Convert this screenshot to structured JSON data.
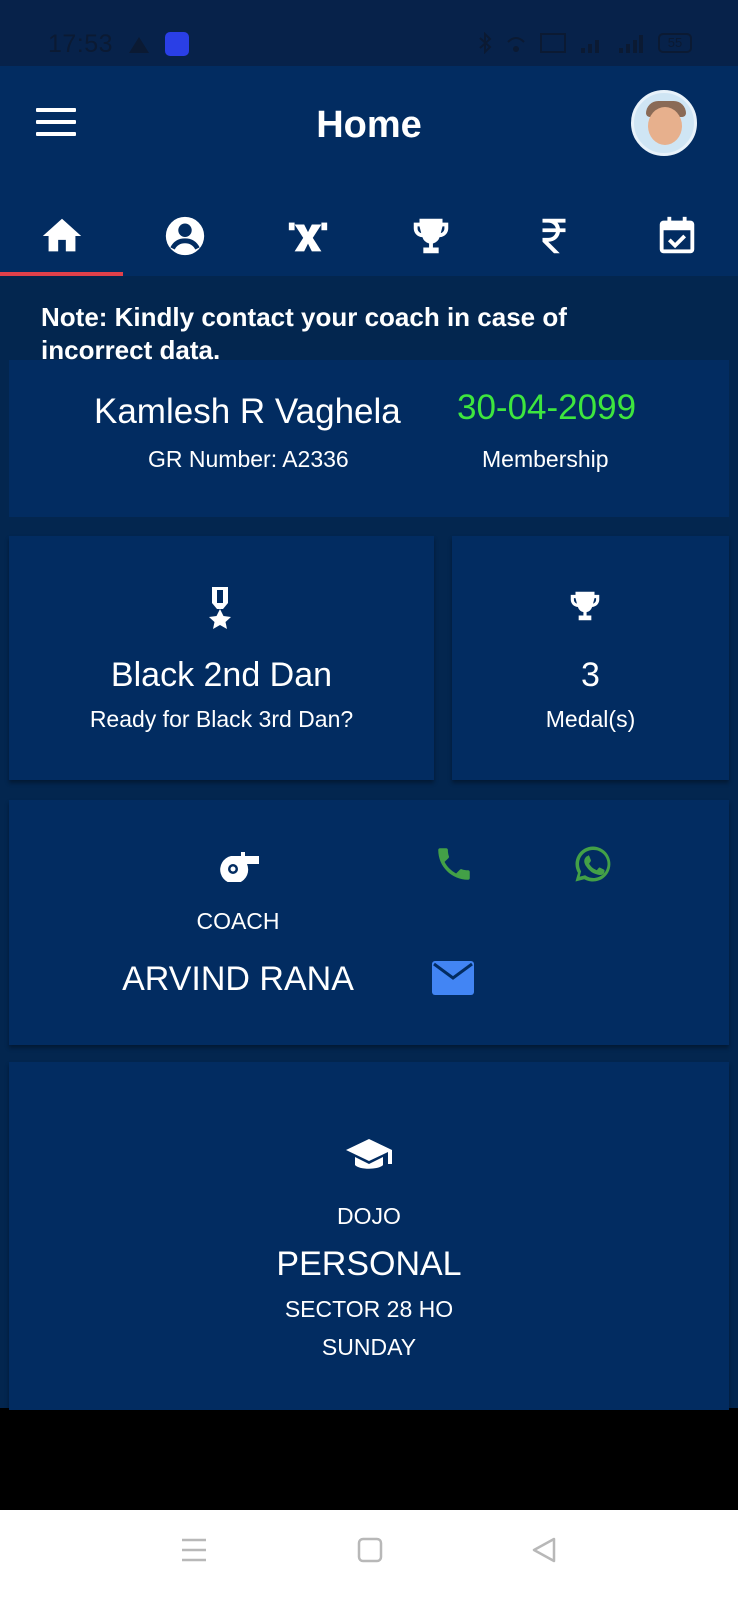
{
  "status_bar": {
    "time": "17:53",
    "battery": "55",
    "icons": [
      "warning-icon",
      "app-notification-icon",
      "bluetooth-icon",
      "wifi-icon",
      "volte-icon",
      "signal-icon",
      "signal-icon",
      "battery-icon"
    ]
  },
  "header": {
    "title": "Home",
    "menu_icon": "hamburger-menu-icon",
    "avatar": "profile-avatar"
  },
  "tabs": [
    {
      "icon": "home-icon",
      "active": true
    },
    {
      "icon": "profile-icon",
      "active": false
    },
    {
      "icon": "exercise-icon",
      "active": false
    },
    {
      "icon": "trophy-icon",
      "active": false
    },
    {
      "icon": "rupee-icon",
      "active": false
    },
    {
      "icon": "calendar-check-icon",
      "active": false
    }
  ],
  "note": "Note: Kindly contact your coach in case of incorrect data.",
  "member": {
    "name": "Kamlesh R Vaghela",
    "gr_number": "GR Number: A2336",
    "expiry_date": "30-04-2099",
    "membership_label": "Membership"
  },
  "belt": {
    "icon": "medal-ribbon-icon",
    "title": "Black 2nd Dan",
    "subtitle": "Ready for Black 3rd Dan?"
  },
  "medals": {
    "icon": "trophy-icon",
    "count": "3",
    "label": "Medal(s)"
  },
  "coach": {
    "icon": "whistle-icon",
    "label": "COACH",
    "name": "ARVIND RANA",
    "actions": [
      "phone-icon",
      "whatsapp-icon",
      "email-icon"
    ]
  },
  "dojo": {
    "icon": "graduation-cap-icon",
    "label": "DOJO",
    "name": "PERSONAL",
    "location": "SECTOR 28 HO",
    "day": "SUNDAY"
  },
  "system_nav": [
    "recent-apps-icon",
    "home-square-icon",
    "back-icon"
  ],
  "colors": {
    "background": "#03264f",
    "card": "#022c61",
    "accent_tab": "#e0404a",
    "expiry_green": "#3ee63e",
    "action_green": "#43a047",
    "email_blue": "#4285f4"
  }
}
